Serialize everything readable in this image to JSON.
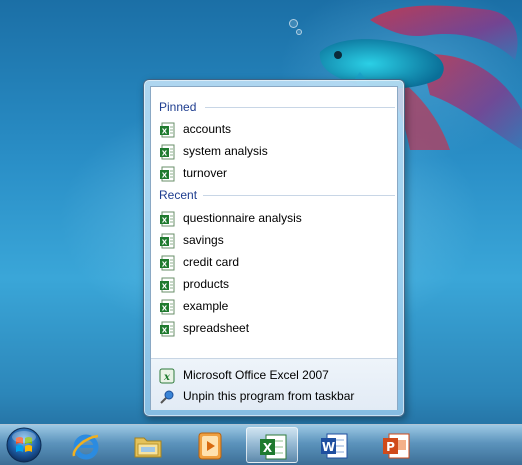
{
  "jumplist": {
    "pinned_header": "Pinned",
    "recent_header": "Recent",
    "pinned": [
      {
        "label": "accounts",
        "icon": "excel-document-icon"
      },
      {
        "label": "system analysis",
        "icon": "excel-document-icon"
      },
      {
        "label": "turnover",
        "icon": "excel-document-icon"
      }
    ],
    "recent": [
      {
        "label": "questionnaire analysis",
        "icon": "excel-document-icon"
      },
      {
        "label": "savings",
        "icon": "excel-document-icon"
      },
      {
        "label": "credit card",
        "icon": "excel-document-icon"
      },
      {
        "label": "products",
        "icon": "excel-document-icon"
      },
      {
        "label": "example",
        "icon": "excel-document-icon"
      },
      {
        "label": "spreadsheet",
        "icon": "excel-document-icon"
      }
    ],
    "tasks": [
      {
        "label": "Microsoft Office Excel 2007",
        "icon": "excel-app-icon"
      },
      {
        "label": "Unpin this program from taskbar",
        "icon": "unpin-icon"
      }
    ]
  },
  "taskbar": {
    "items": [
      {
        "name": "start-button",
        "icon": "windows-orb-icon"
      },
      {
        "name": "internet-explorer",
        "icon": "internet-explorer-icon"
      },
      {
        "name": "windows-explorer",
        "icon": "folder-icon"
      },
      {
        "name": "media-player",
        "icon": "media-player-icon"
      },
      {
        "name": "excel",
        "icon": "excel-icon",
        "active": true
      },
      {
        "name": "word",
        "icon": "word-icon"
      },
      {
        "name": "powerpoint",
        "icon": "powerpoint-icon"
      }
    ]
  },
  "colors": {
    "header_text": "#1e3d8f",
    "excel_green": "#1f7a2e",
    "word_blue": "#1f4fa0",
    "powerpoint_orange": "#d04a1a"
  }
}
